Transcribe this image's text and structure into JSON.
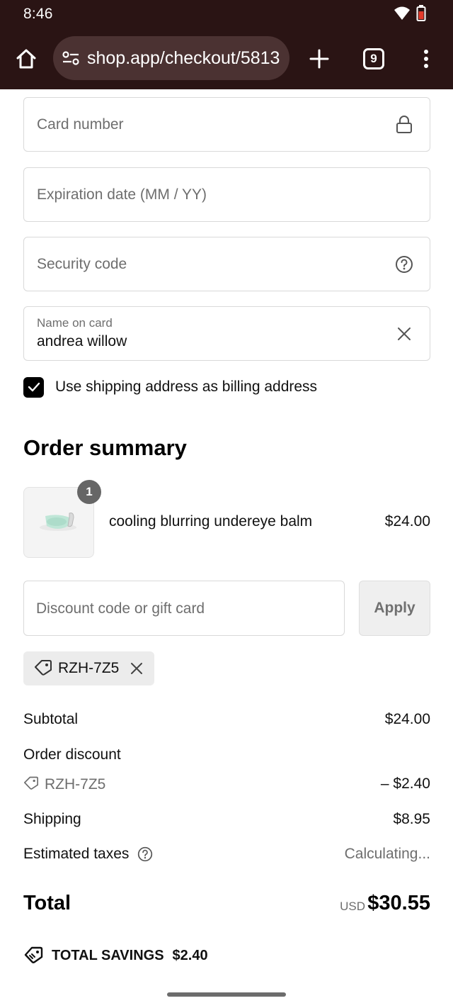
{
  "status_bar": {
    "time": "8:46"
  },
  "browser": {
    "url": "shop.app/checkout/5813",
    "tab_count": "9"
  },
  "payment": {
    "card_number_placeholder": "Card number",
    "expiration_placeholder": "Expiration date (MM / YY)",
    "security_code_placeholder": "Security code",
    "name_label": "Name on card",
    "name_value": "andrea willow",
    "billing_checkbox_label": "Use shipping address as billing address",
    "billing_checked": true
  },
  "order_summary": {
    "title": "Order summary",
    "item": {
      "quantity": "1",
      "name": "cooling blurring undereye balm",
      "price": "$24.00"
    },
    "discount_placeholder": "Discount code or gift card",
    "apply_label": "Apply",
    "applied_code": "RZH-7Z5",
    "subtotal_label": "Subtotal",
    "subtotal_value": "$24.00",
    "order_discount_label": "Order discount",
    "order_discount_code": "RZH-7Z5",
    "order_discount_value": "– $2.40",
    "shipping_label": "Shipping",
    "shipping_value": "$8.95",
    "taxes_label": "Estimated taxes",
    "taxes_value": "Calculating...",
    "total_label": "Total",
    "total_currency": "USD",
    "total_value": "$30.55",
    "savings_label": "TOTAL SAVINGS",
    "savings_value": "$2.40"
  },
  "colors": {
    "toolbar_bg": "#2a1414",
    "urlbar_bg": "#4b3232",
    "checkbox": "#000000",
    "qty_badge": "#666666"
  }
}
